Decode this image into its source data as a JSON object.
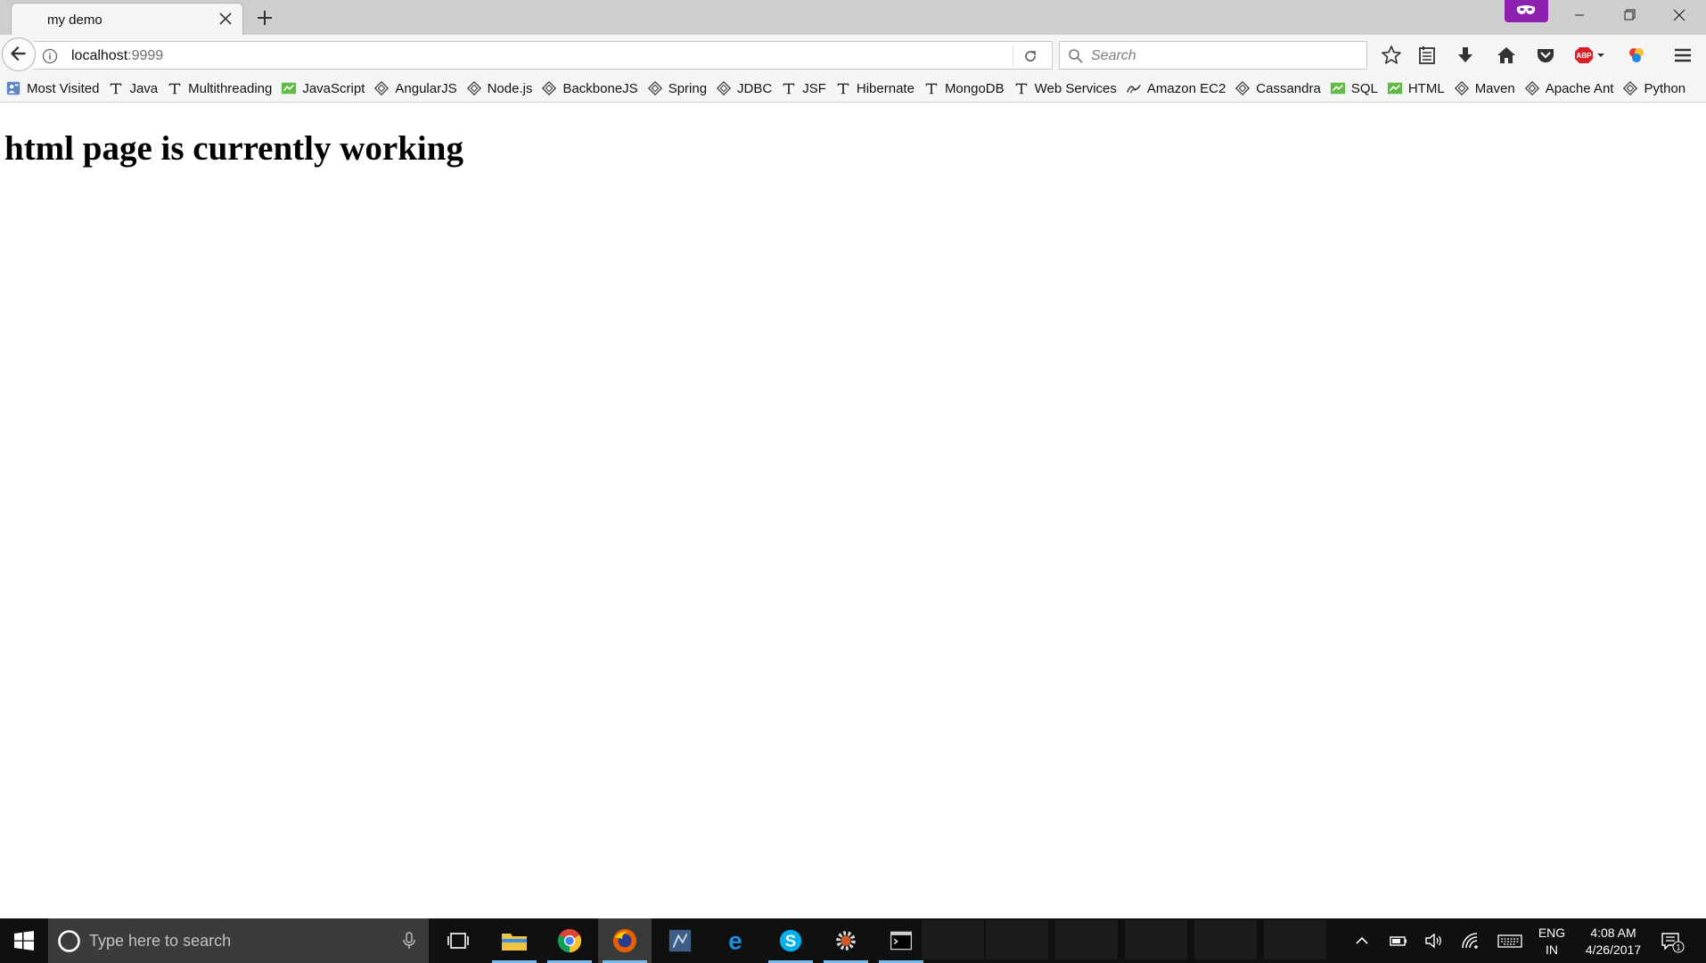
{
  "browser": {
    "tab": {
      "title": "my demo"
    },
    "url": {
      "host": "localhost",
      "port": ":9999"
    },
    "search": {
      "placeholder": "Search"
    }
  },
  "bookmarks": [
    {
      "label": "Most Visited",
      "icon": "most-visited-icon"
    },
    {
      "label": "Java",
      "icon": "serif-t-icon"
    },
    {
      "label": "Multithreading",
      "icon": "serif-t-icon"
    },
    {
      "label": "JavaScript",
      "icon": "green-chart-icon"
    },
    {
      "label": "AngularJS",
      "icon": "diamond-icon"
    },
    {
      "label": "Node.js",
      "icon": "diamond-icon"
    },
    {
      "label": "BackboneJS",
      "icon": "diamond-icon"
    },
    {
      "label": "Spring",
      "icon": "diamond-icon"
    },
    {
      "label": "JDBC",
      "icon": "diamond-icon"
    },
    {
      "label": "JSF",
      "icon": "serif-t-icon"
    },
    {
      "label": "Hibernate",
      "icon": "serif-t-icon"
    },
    {
      "label": "MongoDB",
      "icon": "serif-t-icon"
    },
    {
      "label": "Web Services",
      "icon": "serif-t-icon"
    },
    {
      "label": "Amazon EC2",
      "icon": "wave-icon"
    },
    {
      "label": "Cassandra",
      "icon": "diamond-icon"
    },
    {
      "label": "SQL",
      "icon": "green-chart-icon"
    },
    {
      "label": "HTML",
      "icon": "green-chart-icon"
    },
    {
      "label": "Maven",
      "icon": "diamond-icon"
    },
    {
      "label": "Apache Ant",
      "icon": "diamond-icon"
    },
    {
      "label": "Python",
      "icon": "diamond-icon"
    }
  ],
  "page": {
    "heading": "html page is currently working"
  },
  "taskbar": {
    "search_placeholder": "Type here to search",
    "language": {
      "line1": "ENG",
      "line2": "IN"
    },
    "clock": {
      "time": "4:08 AM",
      "date": "4/26/2017"
    },
    "notifications_count": "1"
  },
  "colors": {
    "private_badge": "#8d20ae",
    "taskbar": "#101010",
    "accent_run": "#76b9ed"
  }
}
